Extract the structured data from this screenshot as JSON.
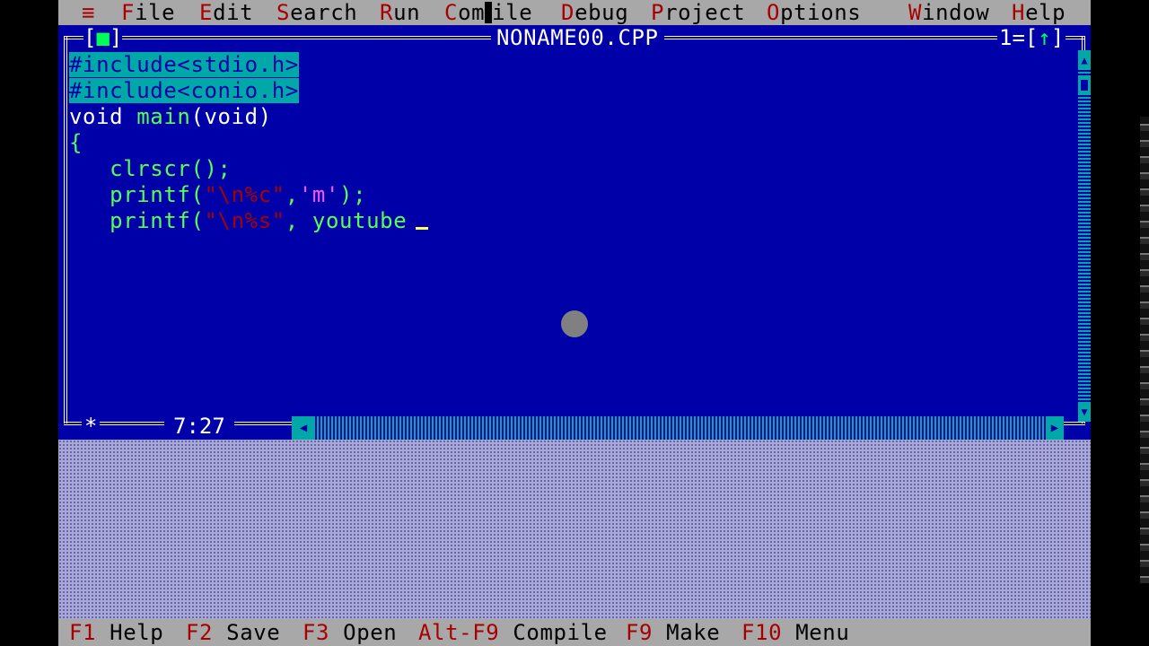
{
  "menu": {
    "system": "≡",
    "items": [
      {
        "hot": "F",
        "rest": "ile"
      },
      {
        "hot": "E",
        "rest": "dit"
      },
      {
        "hot": "S",
        "rest": "earch"
      },
      {
        "hot": "R",
        "rest": "un"
      },
      {
        "hot": "C",
        "rest_a": "om",
        "rest_b": "ile"
      },
      {
        "hot": "D",
        "rest": "ebug"
      },
      {
        "hot": "P",
        "rest": "roject"
      },
      {
        "hot": "O",
        "rest": "ptions"
      },
      {
        "hot": "W",
        "rest": "indow"
      },
      {
        "hot": "H",
        "rest": "elp"
      }
    ]
  },
  "window": {
    "close_left": "[",
    "close_mark": "■",
    "close_right": "]",
    "title": "NONAME00.CPP",
    "number": "1=[",
    "number_arrow": "↑",
    "number_end": "]",
    "position": "7:27",
    "star": "*"
  },
  "code": {
    "line1": "#include<stdio.h>",
    "line2": "#include<conio.h>",
    "line3_kw": "void ",
    "line3_fn": "main",
    "line3_rest": "(void)",
    "line4": "{",
    "line5": "   clrscr();",
    "line6_fn": "   printf(",
    "line6_str": "\"\\n%c\"",
    "line6_comma": ",",
    "line6_chr": "'m'",
    "line6_end": ");",
    "line7_fn": "   printf(",
    "line7_str": "\"\\n%s\"",
    "line7_rest": ", youtube"
  },
  "help": {
    "f1_key": "F1",
    "f1_label": " Help",
    "f2_key": "F2",
    "f2_label": " Save",
    "f3_key": "F3",
    "f3_label": " Open",
    "alt_key": "Alt-F9",
    "alt_label": " Compile",
    "f9_key": "F9",
    "f9_label": " Make",
    "f10_key": "F10",
    "f10_label": " Menu"
  },
  "colors": {
    "editor_bg": "#0000a8",
    "menu_bg": "#a8a8a8",
    "hotkey": "#a80000",
    "highlight": "#00a8a8"
  }
}
